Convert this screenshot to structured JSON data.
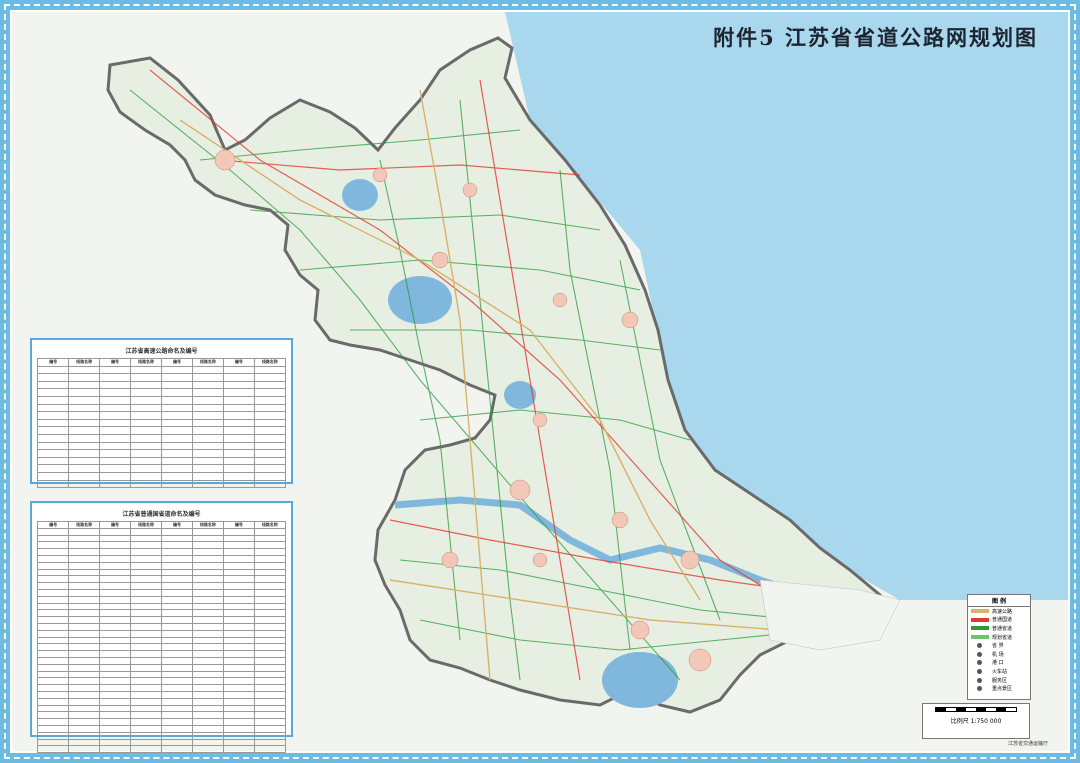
{
  "title": "附件5 江苏省省道公路网规划图",
  "panel1": {
    "title": "江苏省高速公路命名及编号",
    "headers": [
      "编号",
      "线路名称",
      "编号",
      "线路名称",
      "编号",
      "线路名称",
      "编号",
      "线路名称"
    ]
  },
  "panel2": {
    "title": "江苏省普通国省道命名及编号",
    "headers": [
      "编号",
      "线路名称",
      "编号",
      "线路名称",
      "编号",
      "线路名称",
      "编号",
      "线路名称"
    ]
  },
  "legend": {
    "title": "图 例",
    "items": [
      {
        "label": "高速公路",
        "color": "#d9b26a"
      },
      {
        "label": "普通国道",
        "color": "#e23a2e"
      },
      {
        "label": "普通省道",
        "color": "#2c9a3a"
      },
      {
        "label": "规划省道",
        "color": "#6cc46b"
      },
      {
        "label": "省 界",
        "color": "#555555"
      },
      {
        "label": "机 场",
        "color": "#555555"
      },
      {
        "label": "港 口",
        "color": "#555555"
      },
      {
        "label": "火车站",
        "color": "#555555"
      },
      {
        "label": "服务区",
        "color": "#555555"
      },
      {
        "label": "重点景区",
        "color": "#555555"
      }
    ]
  },
  "scale": {
    "label": "比例尺 1:750 000"
  },
  "footer": "江苏省交通运输厅"
}
